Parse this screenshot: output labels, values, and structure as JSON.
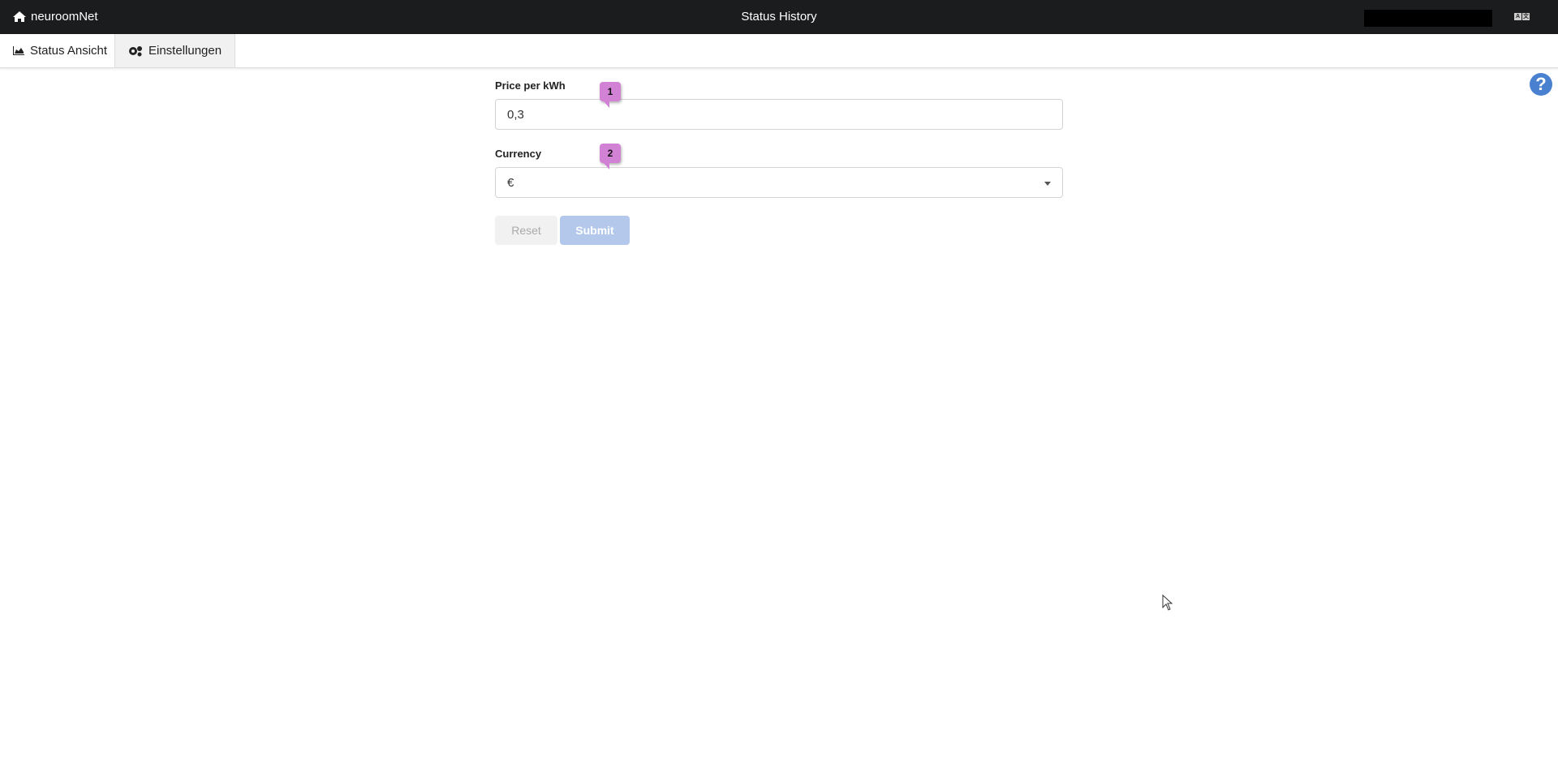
{
  "topbar": {
    "brand": "neuroomNet",
    "title": "Status History",
    "language_icon": "translate-icon"
  },
  "tabs": [
    {
      "label": "Status Ansicht",
      "icon": "area-chart-icon"
    },
    {
      "label": "Einstellungen",
      "icon": "gears-icon",
      "active": true
    }
  ],
  "help_icon": "question-circle-icon",
  "form": {
    "price": {
      "label": "Price per kWh",
      "value": "0,3",
      "badge": "1"
    },
    "currency": {
      "label": "Currency",
      "value": "€",
      "badge": "2"
    },
    "reset_label": "Reset",
    "submit_label": "Submit"
  },
  "colors": {
    "topbar": "#1b1c1e",
    "accent": "#4a80d0",
    "badge": "#d282d5",
    "submit": "#b3c8ea"
  }
}
